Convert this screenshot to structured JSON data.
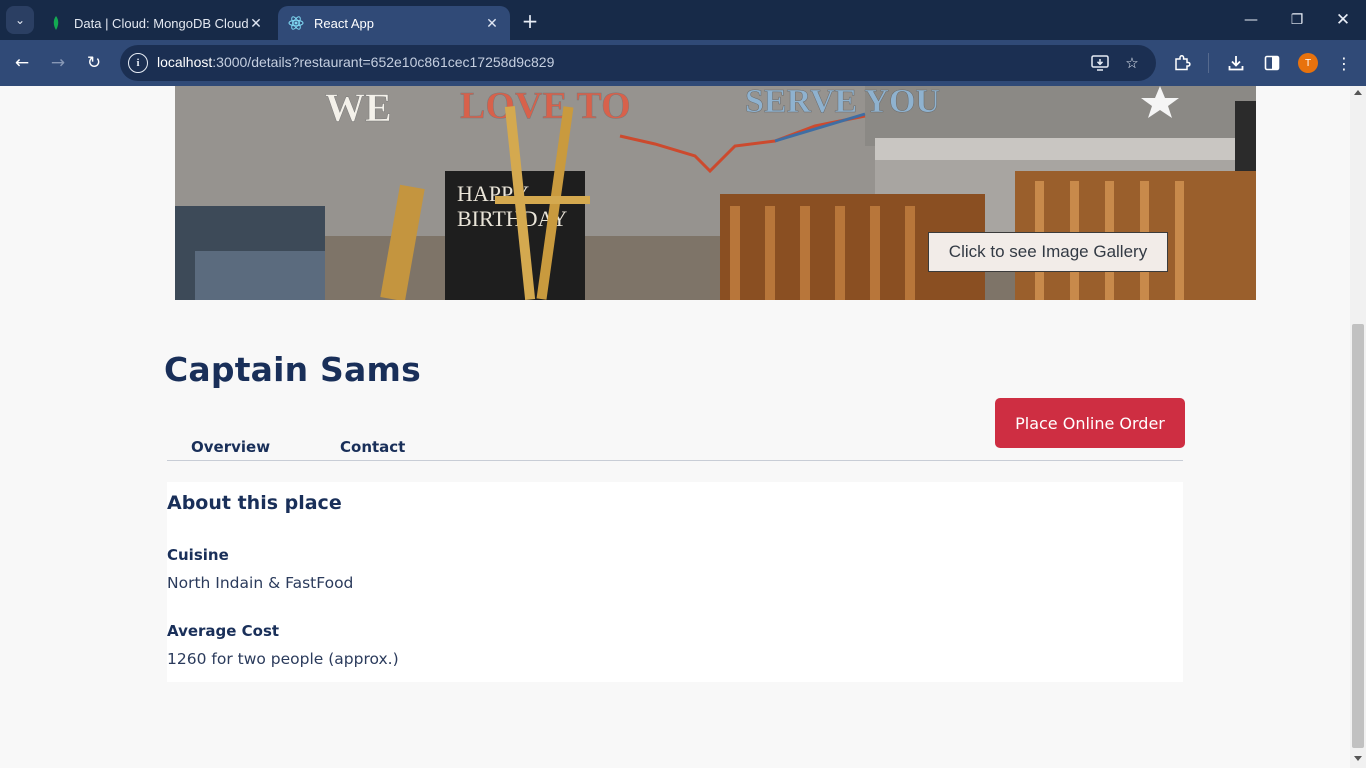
{
  "browser": {
    "tabs": [
      {
        "title": "Data | Cloud: MongoDB Cloud",
        "active": false,
        "favicon": "mongodb-leaf-icon"
      },
      {
        "title": "React App",
        "active": true,
        "favicon": "react-atom-icon"
      }
    ],
    "url_host": "localhost",
    "url_rest": ":3000/details?restaurant=652e10c861cec17258d9c829",
    "profile_initial": "T"
  },
  "hero": {
    "gallery_button": "Click to see Image Gallery",
    "wall_text": "WE LOVE TO SERVE YOU",
    "chalkboard_text": "HAPPY BIRTHDAY"
  },
  "restaurant": {
    "name": "Captain Sams",
    "order_button": "Place Online Order",
    "tabs": [
      "Overview",
      "Contact"
    ],
    "about_heading": "About this place",
    "cuisine_label": "Cuisine",
    "cuisine_value": "North Indain & FastFood",
    "cost_label": "Average Cost",
    "cost_value": "1260 for two people (approx.)"
  },
  "colors": {
    "heading": "#192f59",
    "order_button": "#ce2e42",
    "tabstrip": "#172a48",
    "toolbar": "#304a77"
  }
}
